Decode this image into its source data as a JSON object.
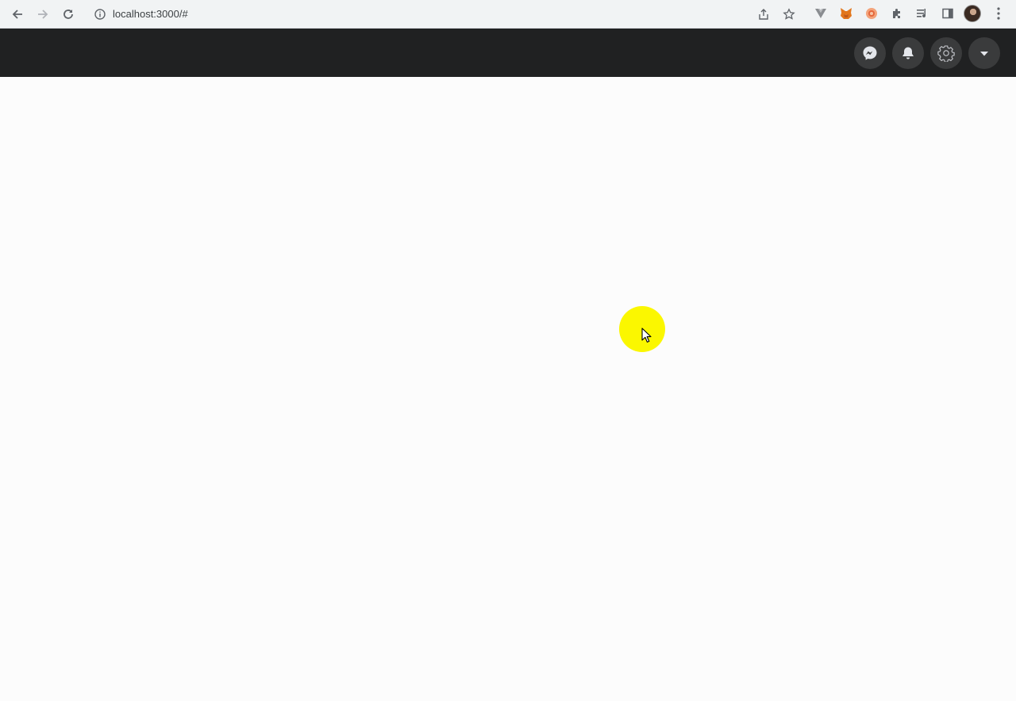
{
  "browser": {
    "url": "localhost:3000/#",
    "icons": {
      "back": "back-arrow-icon",
      "forward": "forward-arrow-icon",
      "reload": "reload-icon",
      "site_info": "info-icon",
      "share": "share-icon",
      "bookmark": "star-icon",
      "extensions": [
        "vue-devtools-icon",
        "metamask-fox-icon",
        "orange-extension-icon",
        "puzzle-extensions-icon",
        "media-queue-icon",
        "side-panel-icon"
      ],
      "profile": "avatar",
      "menu": "kebab-menu-icon"
    }
  },
  "header": {
    "background": "#202122",
    "button_background": "#3a3b3c",
    "buttons": [
      {
        "icon": "messenger-icon"
      },
      {
        "icon": "bell-icon"
      },
      {
        "icon": "gear-icon"
      },
      {
        "icon": "caret-down-icon"
      }
    ]
  },
  "overlay": {
    "cursor_highlight_color": "#fbf700"
  }
}
